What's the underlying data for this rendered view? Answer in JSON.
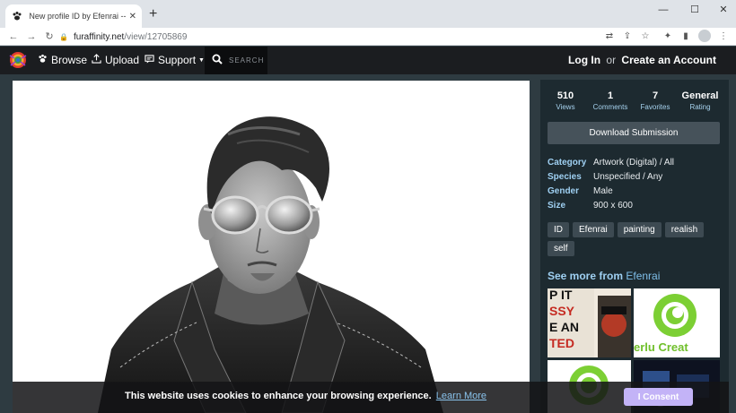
{
  "browser": {
    "tab_title": "New profile ID by Efenrai -- Fur Affinity",
    "tab_close": "✕",
    "new_tab": "+",
    "url_host": "furaffinity.net",
    "url_path": "/view/12705869",
    "window_controls": [
      "—",
      "☐",
      "✕"
    ]
  },
  "nav": {
    "browse_label": "Browse",
    "upload_label": "Upload",
    "support_label": "Support",
    "search_placeholder": "SEARCH",
    "login_label": "Log In",
    "or_label": "or",
    "create_account_label": "Create an Account"
  },
  "stats": [
    {
      "value": "510",
      "label": "Views"
    },
    {
      "value": "1",
      "label": "Comments"
    },
    {
      "value": "7",
      "label": "Favorites"
    },
    {
      "value": "General",
      "label": "Rating"
    }
  ],
  "download_label": "Download Submission",
  "info": {
    "category_key": "Category",
    "category_val": "Artwork (Digital) / All",
    "species_key": "Species",
    "species_val": "Unspecified / Any",
    "gender_key": "Gender",
    "gender_val": "Male",
    "size_key": "Size",
    "size_val": "900 x 600"
  },
  "tags": [
    "ID",
    "Efenrai",
    "painting",
    "realish",
    "self"
  ],
  "see_more": {
    "prefix": "See more from",
    "artist": "Efenrai"
  },
  "thumbnail_texts": {
    "t1": [
      "P IT",
      "SSY",
      "E AN",
      "TED"
    ],
    "t2": "erlu Creat"
  },
  "cookie": {
    "message": "This website uses cookies to enhance your browsing experience.",
    "learn_more": "Learn More",
    "consent_label": "I Consent"
  },
  "colors": {
    "site_bg": "#2e3b41",
    "nav_bg": "#1b1d20",
    "sidebar_bg": "#1d2a30",
    "label_blue": "#9fd0f2",
    "consent_purple": "#c3b3f7"
  },
  "icons": {
    "favicon": "paw-icon",
    "browse": "paw-icon",
    "upload": "upload-icon",
    "support": "chat-icon",
    "search": "search-icon",
    "lock": "lock-icon"
  }
}
